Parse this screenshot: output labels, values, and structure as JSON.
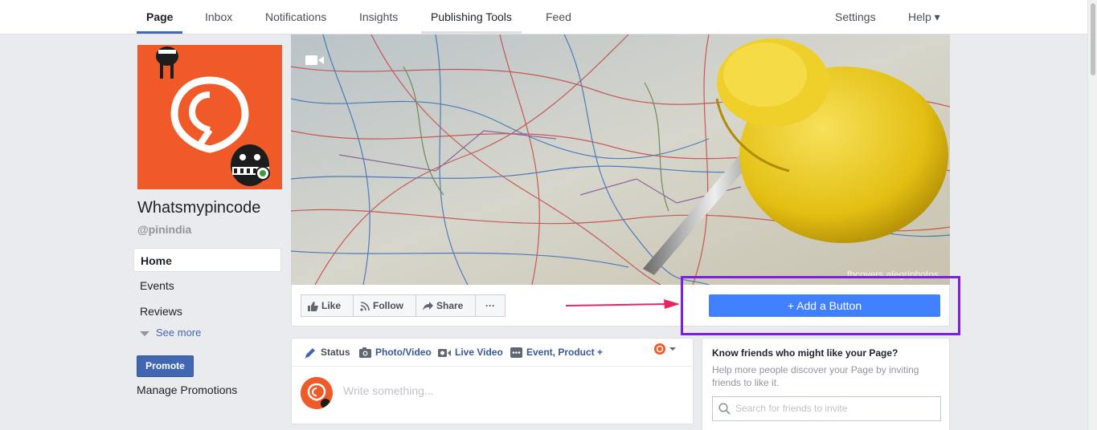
{
  "nav": {
    "tabs": [
      "Page",
      "Inbox",
      "Notifications",
      "Insights",
      "Publishing Tools",
      "Feed"
    ],
    "settings": "Settings",
    "help": "Help ▾"
  },
  "page": {
    "name": "Whatsmypincode",
    "handle": "@pinindia"
  },
  "left_nav": {
    "items": [
      "Home",
      "Events",
      "Reviews"
    ],
    "see_more": "See more",
    "promote": "Promote",
    "manage_promotions": "Manage Promotions"
  },
  "cover": {
    "credit": "fbcovers.alegriphotos"
  },
  "actions": {
    "like": "Like",
    "follow": "Follow",
    "share": "Share",
    "more": "···",
    "add_button": "+ Add a Button"
  },
  "composer": {
    "tabs": [
      "Status",
      "Photo/Video",
      "Live Video",
      "Event, Product +"
    ],
    "placeholder": "Write something..."
  },
  "invite": {
    "title": "Know friends who might like your Page?",
    "description": "Help more people discover your Page by inviting friends to like it.",
    "search_placeholder": "Search for friends to invite"
  },
  "colors": {
    "brand_orange": "#f05a28",
    "fb_blue": "#4267b2",
    "add_button_blue": "#4080ff",
    "highlight_purple": "#7d1fe0",
    "arrow_pink": "#e8245e"
  }
}
